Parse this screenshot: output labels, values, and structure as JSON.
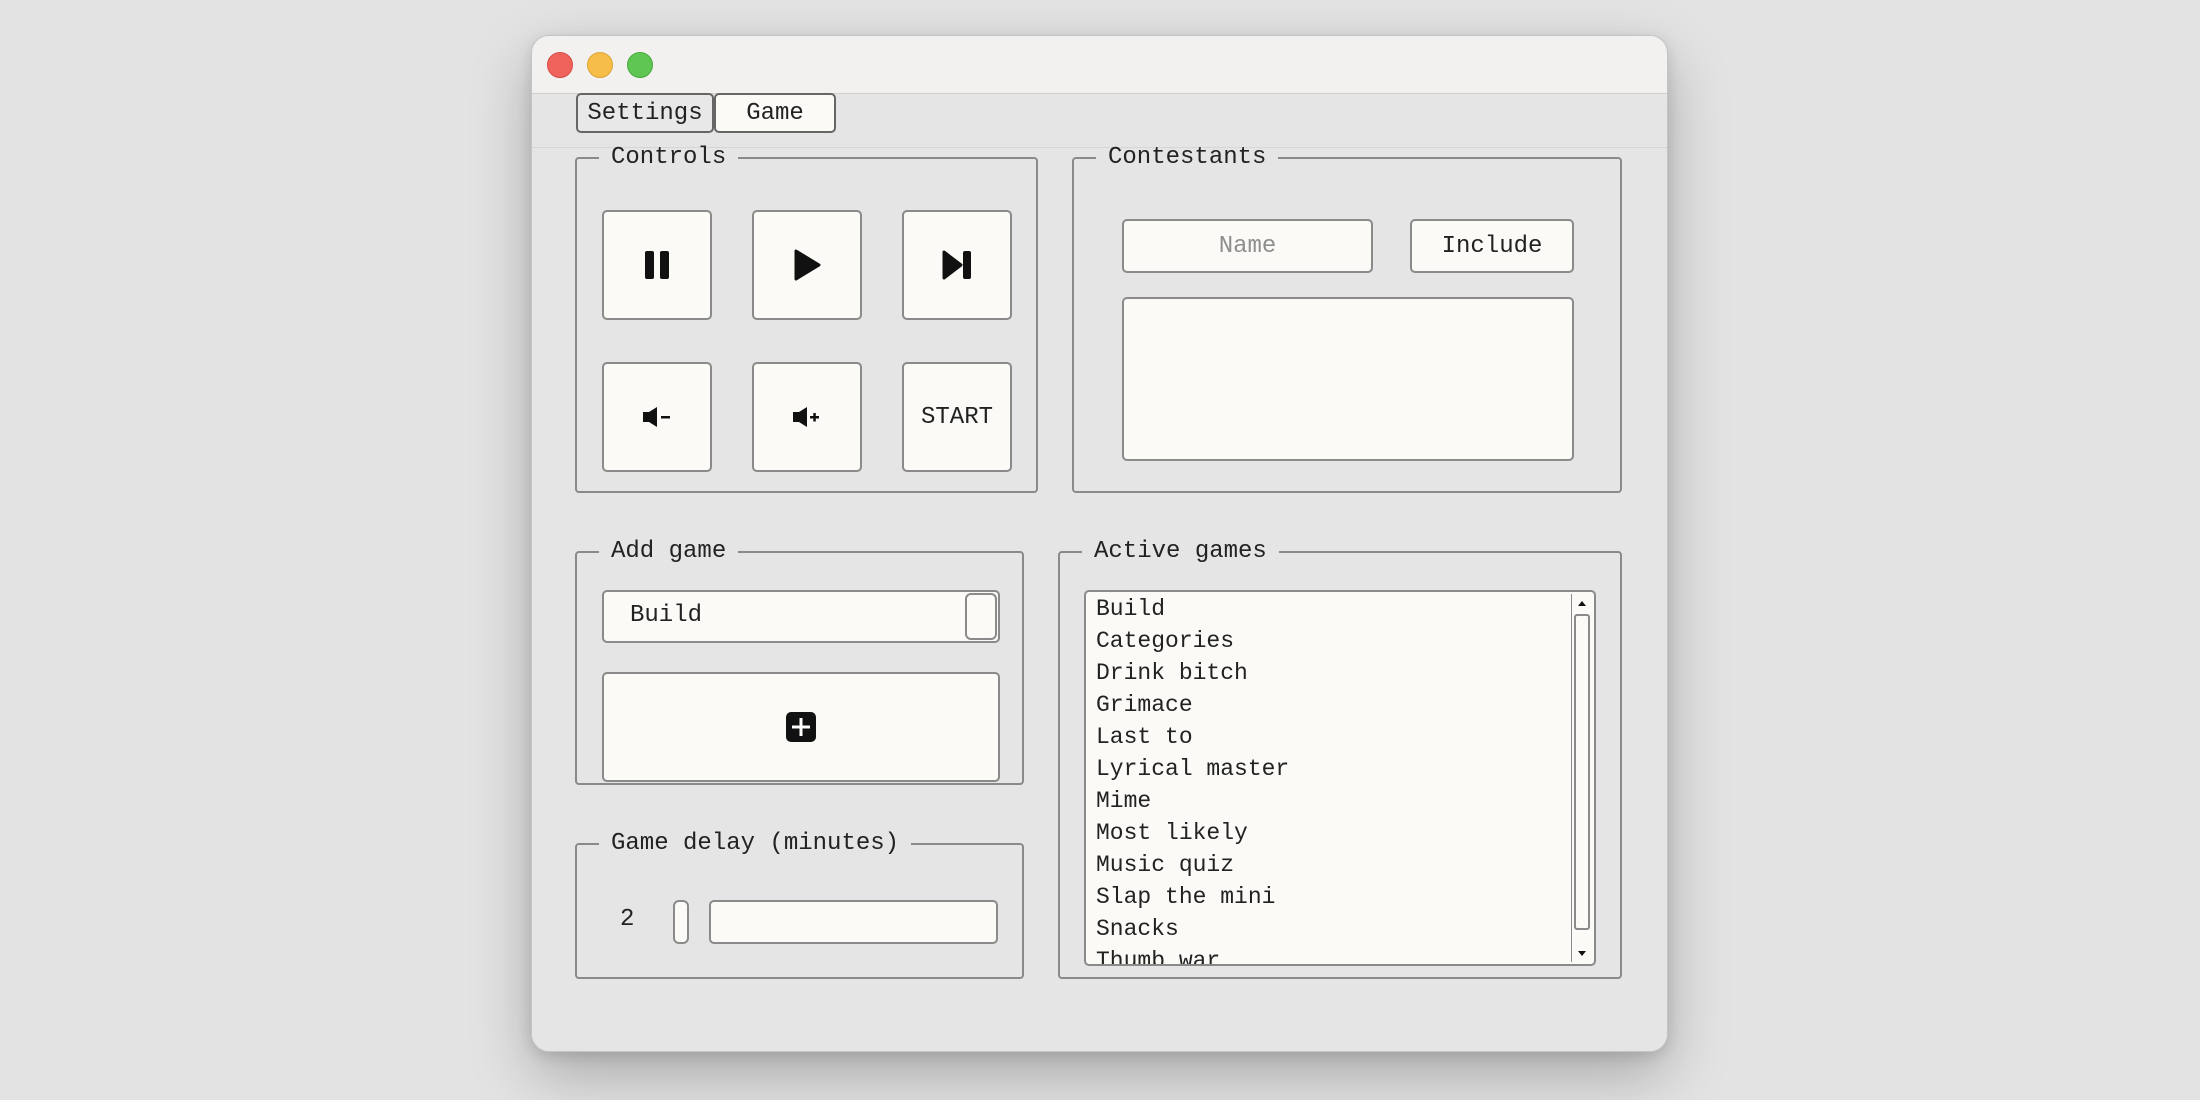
{
  "tabs": {
    "settings": "Settings",
    "game": "Game"
  },
  "controls": {
    "legend": "Controls",
    "buttons": [
      "pause-icon",
      "play-icon",
      "skip-next-icon",
      "volume-down-icon",
      "volume-up-icon"
    ],
    "start_label": "START"
  },
  "contestants": {
    "legend": "Contestants",
    "name_placeholder": "Name",
    "name_value": "",
    "include_label": "Include",
    "list": []
  },
  "add_game": {
    "legend": "Add game",
    "selected": "Build",
    "add_icon": "plus-square-icon"
  },
  "game_delay": {
    "legend": "Game delay (minutes)",
    "value": "2",
    "slider_fraction": 0.0
  },
  "active_games": {
    "legend": "Active games",
    "items": [
      "Build",
      "Categories",
      "Drink bitch",
      "Grimace",
      "Last to",
      "Lyrical master",
      "Mime",
      "Most likely",
      "Music quiz",
      "Slap the mini",
      "Snacks",
      "Thumb war"
    ]
  },
  "colors": {
    "close": "#f0635c",
    "minimize": "#f6be48",
    "zoom": "#5fc654",
    "button_fill": "#fbfaf6",
    "border": "#8a8a8a"
  }
}
